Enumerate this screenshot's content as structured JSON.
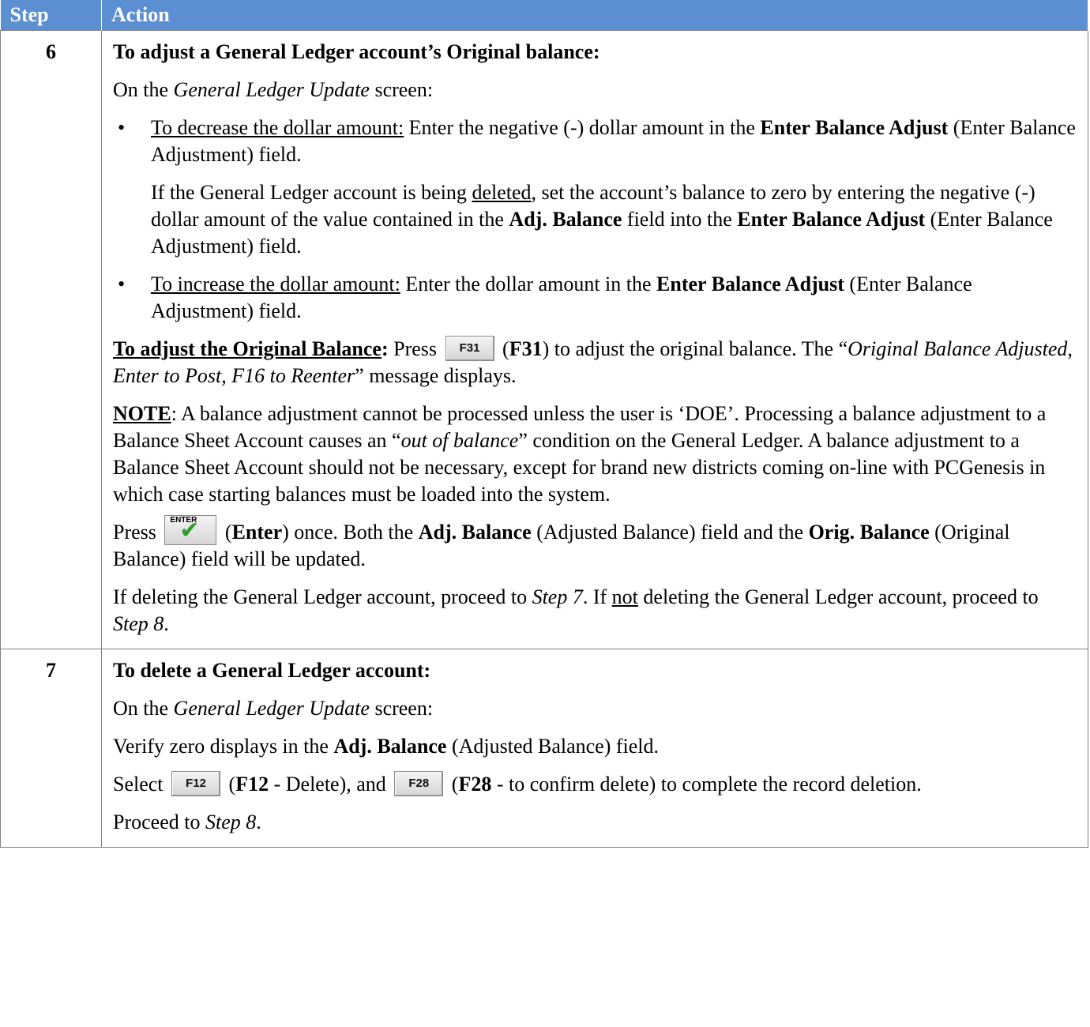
{
  "header": {
    "step": "Step",
    "action": "Action"
  },
  "step6": {
    "number": "6",
    "heading": "To adjust a General Ledger account’s Original balance:",
    "on_screen_pre": "On the ",
    "screen_name": "General Ledger Update",
    "on_screen_post": " screen:",
    "bullet": "•",
    "b1_underlined": "To decrease the dollar amount:",
    "b1_text1": "  Enter the negative (-) dollar amount in the ",
    "b1_bold": "Enter Balance Adjust",
    "b1_text2": " (Enter Balance Adjustment) field.",
    "del_text1": "If the General Ledger account is being ",
    "del_underlined": "deleted",
    "del_text2": ", set the account’s balance to zero by entering the negative (-) dollar amount of the value contained in the ",
    "del_bold1": "Adj. Balance",
    "del_text3": " field into the ",
    "del_bold2": "Enter Balance Adjust",
    "del_text4": " (Enter Balance Adjustment) field.",
    "b2_underlined": "To increase the dollar amount:",
    "b2_text1": "  Enter the dollar amount in the ",
    "b2_bold": "Enter Balance Adjust",
    "b2_text2": " (Enter Balance Adjustment) field.",
    "orig_bold_underlined": "To adjust the Original Balance",
    "orig_colon": ":",
    "orig_press": " Press ",
    "f31_key": "F31",
    "orig_paren_open": " (",
    "f31_bold": "F31",
    "orig_text1": ") to adjust the original balance.  The “",
    "orig_italic": "Original Balance Adjusted, Enter to Post, F16 to Reenter",
    "orig_text2": "” message displays.",
    "note_label": "NOTE",
    "note_text1": ":   A balance adjustment cannot be processed unless the user is ‘DOE’.  Processing a balance adjustment to a Balance Sheet Account causes an “",
    "note_italic": "out of balance",
    "note_text2": "” condition on the General Ledger.  A balance adjustment to a Balance Sheet Account should not be necessary, except for brand new districts coming on-line with PCGenesis in which case starting balances must be loaded into the system.",
    "press": "Press ",
    "enter_key_label": "ENTER",
    "enter_paren_open": " (",
    "enter_bold": "Enter",
    "enter_text1": ") once.  Both the ",
    "enter_bold2": "Adj. Balance",
    "enter_text2": " (Adjusted Balance) field and the ",
    "enter_bold3": "Orig. Balance",
    "enter_text3": " (Original Balance) field will be updated.",
    "proc_text1": "If deleting the General Ledger account, proceed to ",
    "proc_italic1": "Step 7",
    "proc_text2": ".  If ",
    "proc_underlined": "not",
    "proc_text3": " deleting the General Ledger account, proceed to ",
    "proc_italic2": "Step 8",
    "proc_text4": "."
  },
  "step7": {
    "number": "7",
    "heading": "To delete a General Ledger account:",
    "on_screen_pre": "On the ",
    "screen_name": "General Ledger Update",
    "on_screen_post": " screen:",
    "verify_text1": "Verify zero displays in the ",
    "verify_bold": "Adj. Balance",
    "verify_text2": " (Adjusted Balance) field.",
    "select": "Select ",
    "f12_key": "F12",
    "sel_paren_open": " (",
    "f12_bold": "F12",
    "sel_text1": " - Delete), and ",
    "f28_key": "F28",
    "sel_paren_open2": " (",
    "f28_bold": "F28",
    "sel_text2": " - to confirm delete) to complete the record deletion.",
    "proceed_text": "Proceed to ",
    "proceed_italic": "Step 8",
    "proceed_end": "."
  }
}
